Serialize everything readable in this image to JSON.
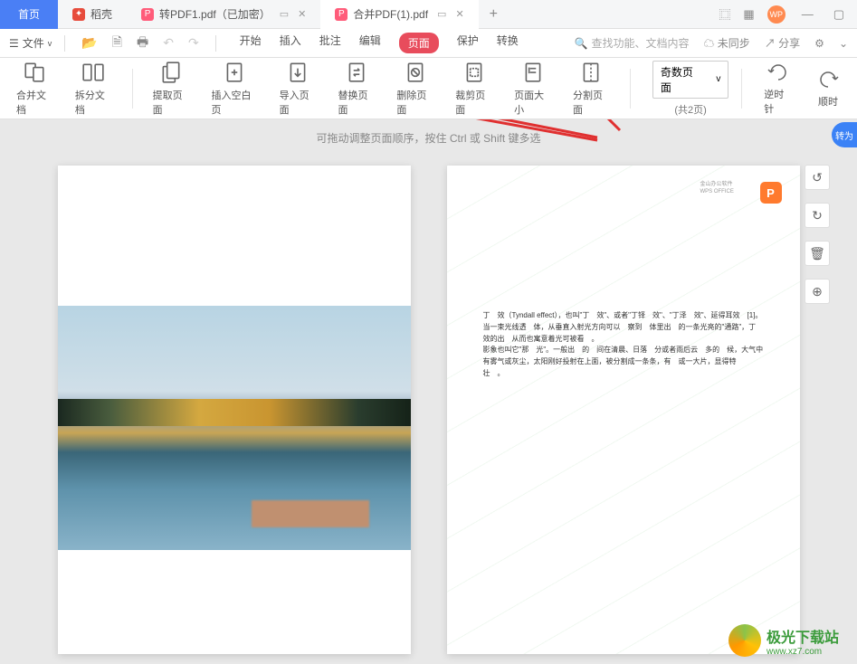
{
  "tabs": {
    "home": "首页",
    "t1": "稻壳",
    "t2": "转PDF1.pdf（已加密）",
    "t3": "合并PDF(1).pdf"
  },
  "titlebar_right": {
    "layout1": "⿴",
    "layout2": "▦"
  },
  "menubar": {
    "file": "文件",
    "items": [
      "开始",
      "插入",
      "批注",
      "编辑",
      "页面",
      "保护",
      "转换"
    ],
    "search_placeholder": "查找功能、文档内容",
    "unsync": "未同步",
    "share": "分享"
  },
  "toolbar": {
    "merge": "合并文档",
    "split": "拆分文档",
    "extract": "提取页面",
    "insert_blank": "插入空白页",
    "import": "导入页面",
    "replace": "替换页面",
    "delete": "删除页面",
    "crop": "裁剪页面",
    "pagesize": "页面大小",
    "split_page": "分割页面",
    "dropdown": "奇数页面",
    "page_count": "(共2页)",
    "rotate_ccw": "逆时针",
    "rotate_cw": "顺时"
  },
  "content": {
    "hint": "可拖动调整页面顺序，按住 Ctrl 或 Shift 键多选",
    "float_badge": "转为"
  },
  "page2": {
    "logo_letter": "P",
    "text": "丁　效（Tyndall effect），也叫\"丁　效\"、或者\"丁铎　效\"、\"丁泽　效\"、延得耳效　[1]。\n当一束光线透　体，从垂直入射光方向可以　察到　体里出　的一条光亮的\"通路\"，丁　效的出　从而也寓意着光可被看　。\n影象也叫它\"那　光\"。一般出　的　间在清晨、日落　分或者雨后云　多的　候，大气中有雾气或灰尘，太阳刚好投射在上面，被分割成一条条，有　或一大片，显得特　壮　。"
  },
  "brand": {
    "name": "极光下载站",
    "url": "www.xz7.com"
  }
}
